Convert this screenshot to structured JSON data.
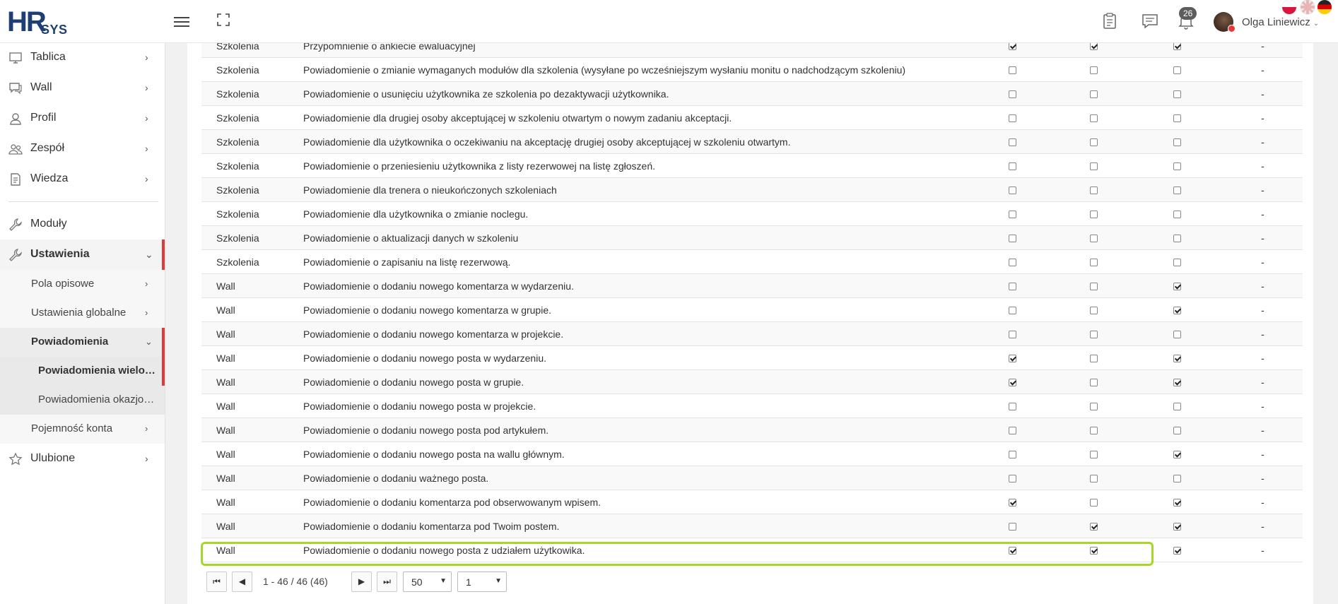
{
  "header": {
    "logo_hr": "HR",
    "logo_sys": "SYS",
    "notification_count": "26",
    "user_name": "Olga Liniewicz",
    "user_caret": "⌄"
  },
  "sidebar": {
    "items": [
      {
        "label": "Tablica",
        "icon": "monitor-icon"
      },
      {
        "label": "Wall",
        "icon": "chat-icon"
      },
      {
        "label": "Profil",
        "icon": "user-icon"
      },
      {
        "label": "Zespół",
        "icon": "team-icon"
      },
      {
        "label": "Wiedza",
        "icon": "document-icon"
      },
      {
        "label": "Moduły",
        "icon": "wrench-icon"
      },
      {
        "label": "Ustawienia",
        "icon": "wrench-icon"
      },
      {
        "label": "Ulubione",
        "icon": "star-icon"
      }
    ],
    "sub_items": [
      {
        "label": "Pola opisowe"
      },
      {
        "label": "Ustawienia globalne"
      },
      {
        "label": "Powiadomienia"
      },
      {
        "label": "Pojemność konta"
      }
    ],
    "sub2_items": [
      {
        "label": "Powiadomienia wielokrotne"
      },
      {
        "label": "Powiadomienia okazjonalne"
      }
    ],
    "chevron_right": "›",
    "chevron_down": "⌄"
  },
  "table": {
    "dash": "-",
    "rows": [
      {
        "module": "Szkolenia",
        "desc": "Przypomnienie o ankiecie ewaluacyjnej",
        "c1": true,
        "c2": true,
        "c3": true
      },
      {
        "module": "Szkolenia",
        "desc": "Powiadomienie o zmianie wymaganych modułów dla szkolenia (wysyłane po wcześniejszym wysłaniu monitu o nadchodzącym szkoleniu)",
        "c1": false,
        "c2": false,
        "c3": false
      },
      {
        "module": "Szkolenia",
        "desc": "Powiadomienie o usunięciu użytkownika ze szkolenia po dezaktywacji użytkownika.",
        "c1": false,
        "c2": false,
        "c3": false
      },
      {
        "module": "Szkolenia",
        "desc": "Powiadomienie dla drugiej osoby akceptującej w szkoleniu otwartym o nowym zadaniu akceptacji.",
        "c1": false,
        "c2": false,
        "c3": false
      },
      {
        "module": "Szkolenia",
        "desc": "Powiadomienie dla użytkownika o oczekiwaniu na akceptację drugiej osoby akceptującej w szkoleniu otwartym.",
        "c1": false,
        "c2": false,
        "c3": false
      },
      {
        "module": "Szkolenia",
        "desc": "Powiadomienie o przeniesieniu użytkownika z listy rezerwowej na listę zgłoszeń.",
        "c1": false,
        "c2": false,
        "c3": false
      },
      {
        "module": "Szkolenia",
        "desc": "Powiadomienie dla trenera o nieukończonych szkoleniach",
        "c1": false,
        "c2": false,
        "c3": false
      },
      {
        "module": "Szkolenia",
        "desc": "Powiadomienie dla użytkownika o zmianie noclegu.",
        "c1": false,
        "c2": false,
        "c3": false
      },
      {
        "module": "Szkolenia",
        "desc": "Powiadomienie o aktualizacji danych w szkoleniu",
        "c1": false,
        "c2": false,
        "c3": false
      },
      {
        "module": "Szkolenia",
        "desc": "Powiadomienie o zapisaniu na listę rezerwową.",
        "c1": false,
        "c2": false,
        "c3": false
      },
      {
        "module": "Wall",
        "desc": "Powiadomienie o dodaniu nowego komentarza w wydarzeniu.",
        "c1": false,
        "c2": false,
        "c3": true
      },
      {
        "module": "Wall",
        "desc": "Powiadomienie o dodaniu nowego komentarza w grupie.",
        "c1": false,
        "c2": false,
        "c3": true
      },
      {
        "module": "Wall",
        "desc": "Powiadomienie o dodaniu nowego komentarza w projekcie.",
        "c1": false,
        "c2": false,
        "c3": false
      },
      {
        "module": "Wall",
        "desc": "Powiadomienie o dodaniu nowego posta w wydarzeniu.",
        "c1": true,
        "c2": false,
        "c3": true
      },
      {
        "module": "Wall",
        "desc": "Powiadomienie o dodaniu nowego posta w grupie.",
        "c1": true,
        "c2": false,
        "c3": true
      },
      {
        "module": "Wall",
        "desc": "Powiadomienie o dodaniu nowego posta w projekcie.",
        "c1": false,
        "c2": false,
        "c3": false
      },
      {
        "module": "Wall",
        "desc": "Powiadomienie o dodaniu nowego posta pod artykułem.",
        "c1": false,
        "c2": false,
        "c3": false
      },
      {
        "module": "Wall",
        "desc": "Powiadomienie o dodaniu nowego posta na wallu głównym.",
        "c1": false,
        "c2": false,
        "c3": true
      },
      {
        "module": "Wall",
        "desc": "Powiadomienie o dodaniu ważnego posta.",
        "c1": false,
        "c2": false,
        "c3": false
      },
      {
        "module": "Wall",
        "desc": "Powiadomienie o dodaniu komentarza pod obserwowanym wpisem.",
        "c1": true,
        "c2": false,
        "c3": true
      },
      {
        "module": "Wall",
        "desc": "Powiadomienie o dodaniu komentarza pod Twoim postem.",
        "c1": false,
        "c2": true,
        "c3": true
      },
      {
        "module": "Wall",
        "desc": "Powiadomienie o dodaniu nowego posta z udziałem użytkowika.",
        "c1": true,
        "c2": true,
        "c3": true
      }
    ]
  },
  "pagination": {
    "first": "⏮",
    "prev": "◀",
    "next": "▶",
    "last": "⏭",
    "info": "1 - 46 / 46 (46)",
    "per_page": "50",
    "page": "1",
    "arrow": "▼"
  },
  "colors": {
    "accent": "#e03b3b",
    "highlight": "#a7d52a",
    "logo": "#1e3f73"
  }
}
